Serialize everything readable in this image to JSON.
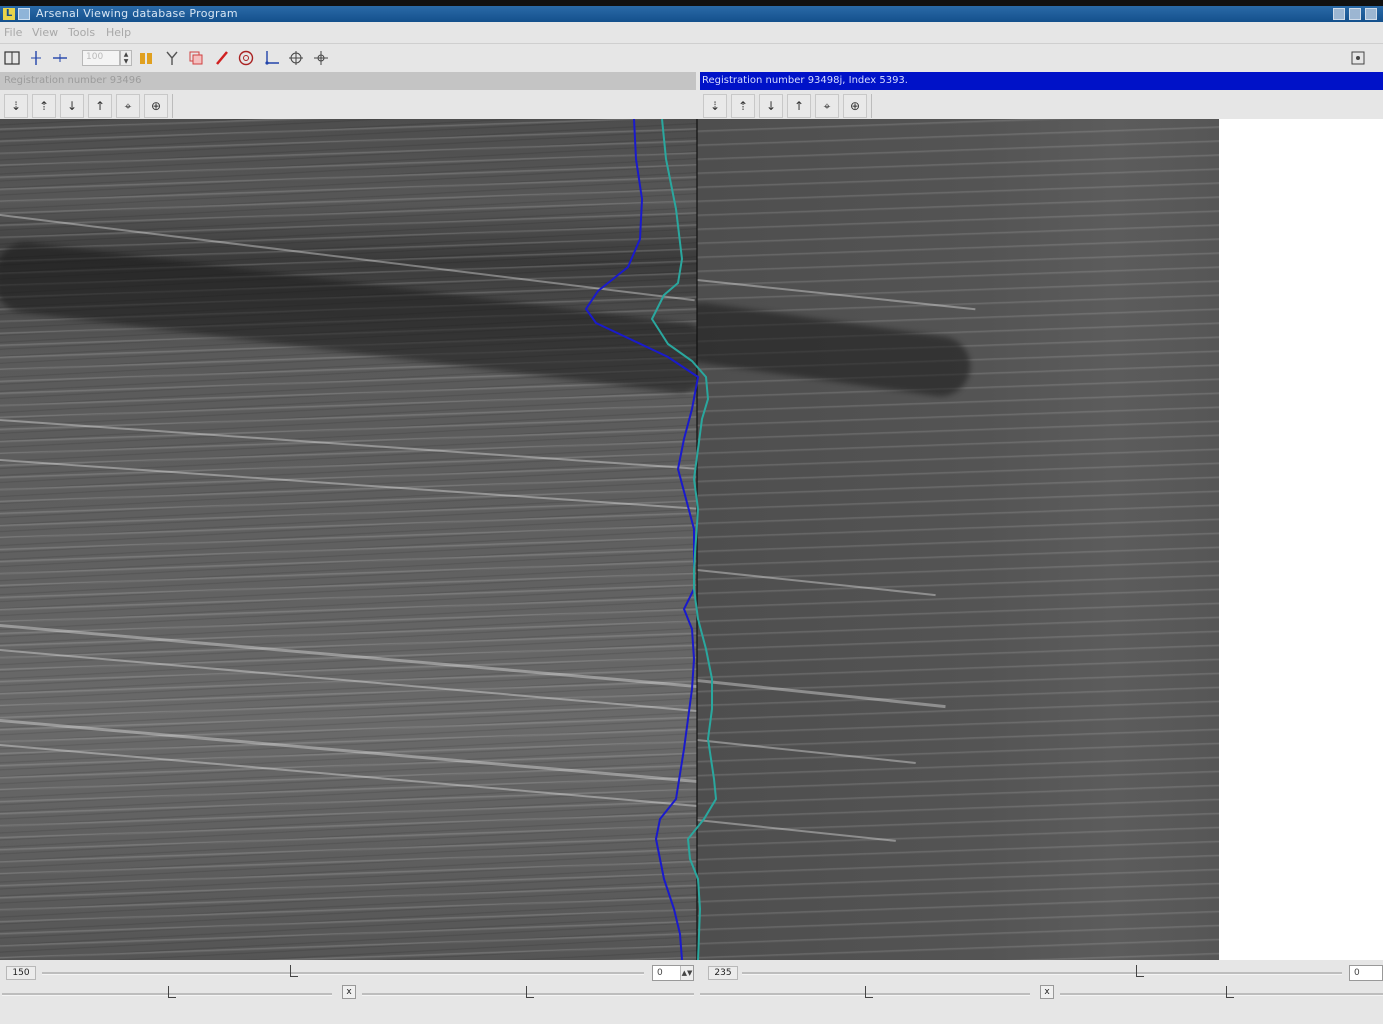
{
  "window": {
    "title": "Arsenal  Viewing database Program",
    "app_icon_letter": "L"
  },
  "menu": [
    {
      "label": "File"
    },
    {
      "label": "View"
    },
    {
      "label": "Tools"
    },
    {
      "label": "Help"
    }
  ],
  "toolbar": {
    "zoom_value": "100",
    "icons": [
      "layout-icon",
      "vertical-cursor-icon",
      "horizontal-cursor-icon",
      "zoom-spinner",
      "compare-icon",
      "filter-icon",
      "overlay-icon",
      "pen-icon",
      "target-icon",
      "axes-icon",
      "crosshair-icon",
      "move-icon"
    ]
  },
  "panels": {
    "left_header": "Registration number 93496",
    "right_header": "Registration number 93498j, Index 5393."
  },
  "bottom": {
    "left_value": "150",
    "right_value": "235",
    "left_spin_value": "0",
    "right_spin_value": "0",
    "close_glyph": "x"
  },
  "colors": {
    "profile_blue": "#1a1acc",
    "profile_teal": "#2aa79e",
    "header_active": "#0012c8"
  }
}
